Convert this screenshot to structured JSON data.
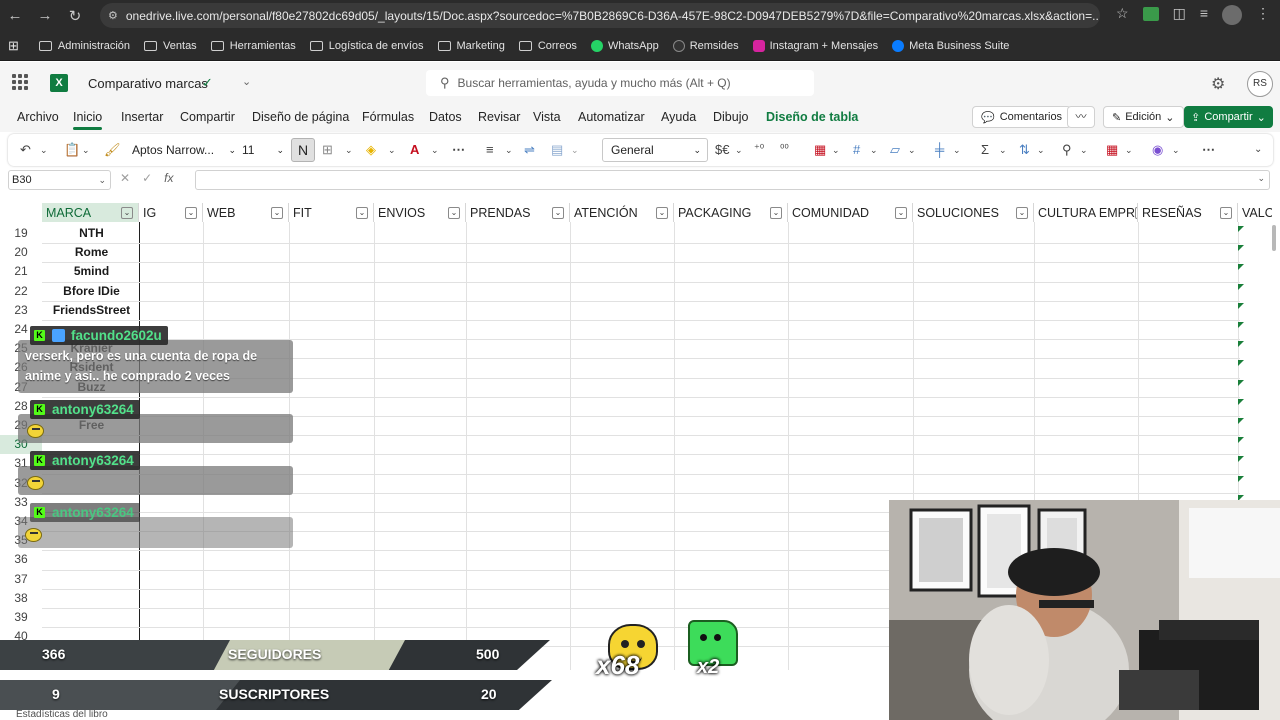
{
  "browser": {
    "url": "onedrive.live.com/personal/f80e27802dc69d05/_layouts/15/Doc.aspx?sourcedoc=%7B0B2869C6-D36A-457E-98C2-D0947DEB5279%7D&file=Comparativo%20marcas.xlsx&action=...",
    "bookmarks": [
      "Administración",
      "Ventas",
      "Herramientas",
      "Logística de envíos",
      "Marketing",
      "Correos",
      "WhatsApp",
      "Remsides",
      "Instagram + Mensajes",
      "Meta Business Suite"
    ]
  },
  "app": {
    "doc_name": "Comparativo marcas",
    "search_placeholder": "Buscar herramientas, ayuda y mucho más (Alt + Q)",
    "avatar_initials": "RS"
  },
  "ribbon": {
    "tabs": [
      "Archivo",
      "Inicio",
      "Insertar",
      "Compartir",
      "Diseño de página",
      "Fórmulas",
      "Datos",
      "Revisar",
      "Vista",
      "Automatizar",
      "Ayuda",
      "Dibujo",
      "Diseño de tabla"
    ],
    "active_tab": "Inicio",
    "comments": "Comentarios",
    "editing": "Edición",
    "share": "Compartir"
  },
  "toolbar": {
    "font": "Aptos Narrow...",
    "size": "11",
    "bold": "N",
    "number_format": "General"
  },
  "formula": {
    "name_box": "B30",
    "fx": "fx"
  },
  "columns": [
    "MARCA",
    "IG",
    "WEB",
    "FIT",
    "ENVIOS",
    "PRENDAS",
    "ATENCIÓN",
    "PACKAGING",
    "COMUNIDAD",
    "SOLUCIONES",
    "CULTURA EMPR",
    "RESEÑAS",
    "VALO"
  ],
  "rows": [
    {
      "n": "19",
      "marca": "NTH"
    },
    {
      "n": "20",
      "marca": "Rome"
    },
    {
      "n": "21",
      "marca": "5mind"
    },
    {
      "n": "22",
      "marca": "Bfore IDie"
    },
    {
      "n": "23",
      "marca": "FriendsStreet"
    },
    {
      "n": "24",
      "marca": ""
    },
    {
      "n": "25",
      "marca": "Kranier"
    },
    {
      "n": "26",
      "marca": "Rsident"
    },
    {
      "n": "27",
      "marca": "Buzz"
    },
    {
      "n": "28",
      "marca": ""
    },
    {
      "n": "29",
      "marca": "Free"
    },
    {
      "n": "30",
      "marca": ""
    },
    {
      "n": "31",
      "marca": ""
    },
    {
      "n": "32",
      "marca": ""
    },
    {
      "n": "33",
      "marca": ""
    },
    {
      "n": "34",
      "marca": ""
    },
    {
      "n": "35",
      "marca": ""
    },
    {
      "n": "36",
      "marca": ""
    },
    {
      "n": "37",
      "marca": ""
    },
    {
      "n": "38",
      "marca": ""
    },
    {
      "n": "39",
      "marca": ""
    },
    {
      "n": "40",
      "marca": ""
    }
  ],
  "chat": [
    {
      "user": "facundo2602u",
      "message_lines": [
        "verserk, pero es una cuenta de ropa de",
        "anime y asi.. he comprado 2 veces"
      ]
    },
    {
      "user": "antony63264",
      "message_lines": []
    },
    {
      "user": "antony63264",
      "message_lines": []
    },
    {
      "user": "antony63264",
      "message_lines": []
    }
  ],
  "stream": {
    "followers_count": "366",
    "followers_label": "SEGUIDORES",
    "followers_goal": "500",
    "subs_count": "9",
    "subs_label": "SUSCRIPTORES",
    "subs_goal": "20",
    "emote1_count": "x68",
    "emote2_count": "x2"
  },
  "sheet_status": "Estadísticas del libro",
  "colors": {
    "excel_green": "#107c41",
    "chat_name_green": "#52e18a"
  }
}
